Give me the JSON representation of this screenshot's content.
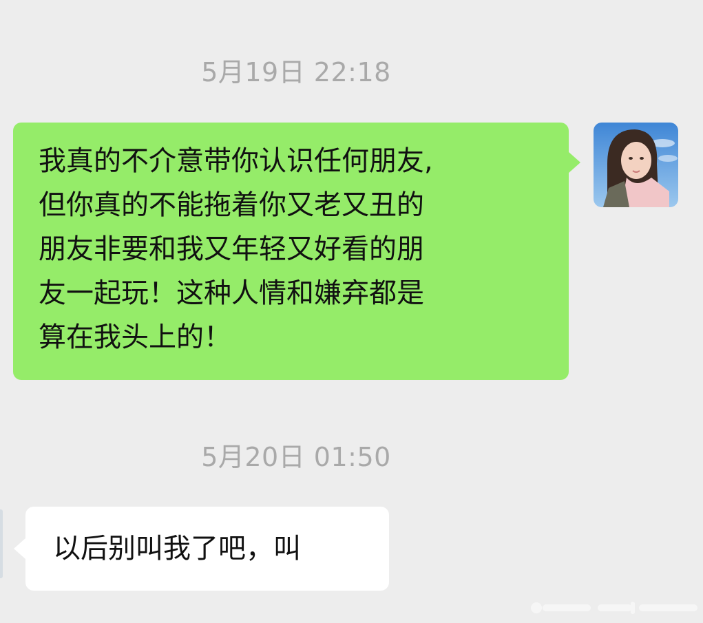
{
  "colors": {
    "background": "#ededed",
    "outgoing_bubble": "#95ec69",
    "incoming_bubble": "#ffffff",
    "timestamp_text": "#a9a9a9",
    "message_text": "#111111"
  },
  "messages": [
    {
      "timestamp": "5月19日 22:18",
      "direction": "outgoing",
      "lines": [
        "我真的不介意带你认识任何朋友,",
        "但你真的不能拖着你又老又丑的",
        "朋友非要和我又年轻又好看的朋",
        "友一起玩！这种人情和嫌弃都是",
        "算在我头上的！"
      ],
      "avatar_icon": "user-avatar-photo"
    },
    {
      "timestamp": "5月20日 01:50",
      "direction": "incoming",
      "text": "以后别叫我了吧，叫",
      "avatar_icon": "contact-avatar-photo"
    }
  ]
}
